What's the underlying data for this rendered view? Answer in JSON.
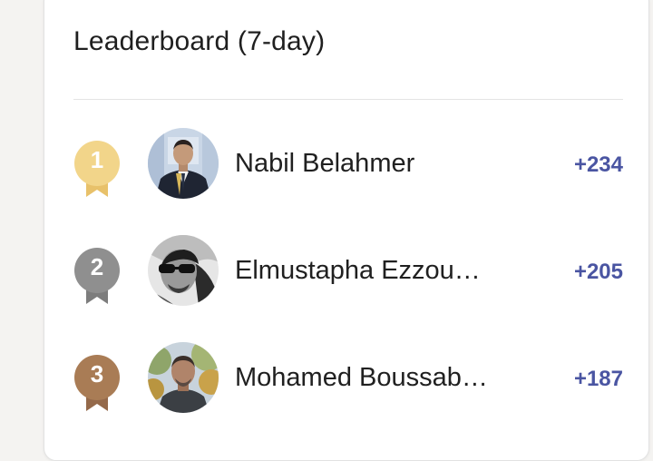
{
  "leaderboard": {
    "title": "Leaderboard (7-day)",
    "entries": [
      {
        "rank": "1",
        "name": "Nabil Belahmer",
        "score": "+234",
        "medal_color": "#f2d58a"
      },
      {
        "rank": "2",
        "name": "Elmustapha Ezzou…",
        "score": "+205",
        "medal_color": "#8f8f8f"
      },
      {
        "rank": "3",
        "name": "Mohamed Boussab…",
        "score": "+187",
        "medal_color": "#a97c55"
      }
    ]
  },
  "colors": {
    "score": "#4a55a2",
    "card_background": "#ffffff",
    "page_background": "#f4f3f1"
  }
}
